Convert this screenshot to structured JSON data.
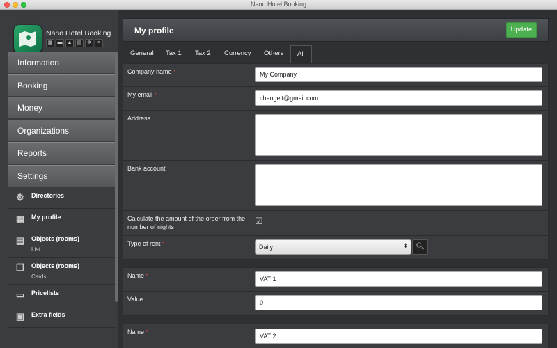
{
  "window": {
    "title": "Nano Hotel Booking"
  },
  "brand": {
    "name": "Nano Hotel Booking"
  },
  "menu": {
    "items": [
      "Information",
      "Booking",
      "Money",
      "Organizations",
      "Reports",
      "Settings"
    ],
    "sub": [
      {
        "label": "Directories",
        "sub": ""
      },
      {
        "label": "My profile",
        "sub": ""
      },
      {
        "label": "Objects (rooms)",
        "sub": "List"
      },
      {
        "label": "Objects (rooms)",
        "sub": "Cards"
      },
      {
        "label": "Pricelists",
        "sub": ""
      },
      {
        "label": "Extra fields",
        "sub": ""
      }
    ]
  },
  "header": {
    "title": "My profile",
    "update_label": "Update"
  },
  "tabs": [
    "General",
    "Tax 1",
    "Tax 2",
    "Currency",
    "Others",
    "All"
  ],
  "active_tab": "All",
  "form": {
    "company_name": {
      "label": "Company name",
      "value": "My Company"
    },
    "email": {
      "label": "My email",
      "value": "changeit@gmail.com"
    },
    "address": {
      "label": "Address",
      "value": ""
    },
    "bank": {
      "label": "Bank account",
      "value": ""
    },
    "calc": {
      "label": "Calculate the amount of the order from the number of nights",
      "checked": true
    },
    "rent": {
      "label": "Type of rent",
      "value": "Daily"
    }
  },
  "tax1": {
    "name_label": "Name",
    "name_value": "VAT 1",
    "value_label": "Value",
    "value_value": "0"
  },
  "tax2": {
    "name_label": "Name",
    "name_value": "VAT 2"
  }
}
